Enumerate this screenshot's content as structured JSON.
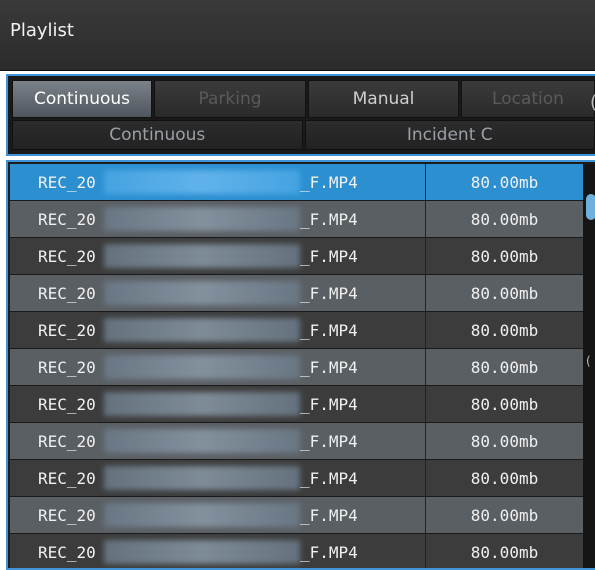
{
  "window": {
    "title": "Playlist"
  },
  "tabs_row1": [
    {
      "label": "Continuous",
      "state": "active"
    },
    {
      "label": "Parking",
      "state": "disabled"
    },
    {
      "label": "Manual",
      "state": "normal"
    },
    {
      "label": "Location",
      "state": "disabled"
    }
  ],
  "tabs_row2": [
    {
      "label": "Continuous"
    },
    {
      "label": "Incident C"
    }
  ],
  "list": {
    "rows": [
      {
        "prefix": "REC_20",
        "suffix": "_F.MP4",
        "size": "80.00mb"
      },
      {
        "prefix": "REC_20",
        "suffix": "_F.MP4",
        "size": "80.00mb"
      },
      {
        "prefix": "REC_20",
        "suffix": "_F.MP4",
        "size": "80.00mb"
      },
      {
        "prefix": "REC_20",
        "suffix": "_F.MP4",
        "size": "80.00mb"
      },
      {
        "prefix": "REC_20",
        "suffix": "_F.MP4",
        "size": "80.00mb"
      },
      {
        "prefix": "REC_20",
        "suffix": "_F.MP4",
        "size": "80.00mb"
      },
      {
        "prefix": "REC_20",
        "suffix": "_F.MP4",
        "size": "80.00mb"
      },
      {
        "prefix": "REC_20",
        "suffix": "_F.MP4",
        "size": "80.00mb"
      },
      {
        "prefix": "REC_20",
        "suffix": "_F.MP4",
        "size": "80.00mb"
      },
      {
        "prefix": "REC_20",
        "suffix": "_F.MP4",
        "size": "80.00mb"
      },
      {
        "prefix": "REC_20",
        "suffix": "_F.MP4",
        "size": "80.00mb"
      }
    ]
  },
  "colors": {
    "accent": "#3f93d6",
    "selected_row": "#2b8fd0"
  }
}
